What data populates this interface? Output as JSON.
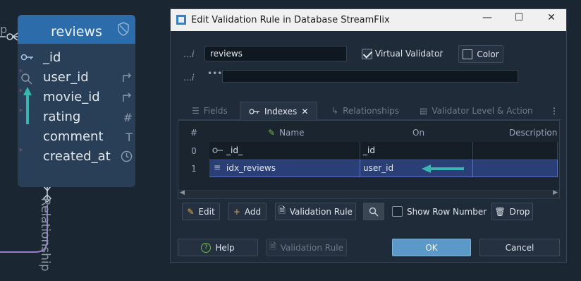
{
  "entity": {
    "name": "reviews",
    "fields": [
      {
        "name": "_id",
        "key_icon": "key-icon",
        "type_icon": ""
      },
      {
        "name": "user_id",
        "key_icon": "search-icon",
        "type_icon": "arrow-right-icon"
      },
      {
        "name": "movie_id",
        "key_icon": "",
        "type_icon": "arrow-right-icon"
      },
      {
        "name": "rating",
        "key_icon": "",
        "type_icon": "#"
      },
      {
        "name": "comment",
        "key_icon": "",
        "type_icon": "T"
      },
      {
        "name": "created_at",
        "key_icon": "",
        "type_icon": "clock-icon"
      }
    ],
    "relationship_label": "Relationship",
    "edge_label_fragment": "p"
  },
  "dialog": {
    "title": "Edit Validation Rule in Database StreamFlix",
    "name_value": "reviews",
    "virtual_validator_label": "Virtual Validator",
    "virtual_validator_checked": true,
    "color_label": "Color",
    "comment_value": "",
    "tabs": [
      {
        "label": "Fields",
        "active": false
      },
      {
        "label": "Indexes",
        "active": true
      },
      {
        "label": "Relationships",
        "active": false
      },
      {
        "label": "Validator Level & Action",
        "active": false
      }
    ],
    "grid": {
      "headers": {
        "num": "#",
        "name": "Name",
        "on": "On",
        "description": "Description"
      },
      "rows": [
        {
          "num": "0",
          "name": "_id_",
          "on": "_id",
          "description": "",
          "selected": false
        },
        {
          "num": "1",
          "name": "idx_reviews",
          "on": "user_id",
          "description": "",
          "selected": true
        }
      ]
    },
    "toolbar": {
      "edit": "Edit",
      "add": "Add",
      "validation_rule": "Validation Rule",
      "show_row_number": "Show Row Number",
      "drop": "Drop"
    },
    "footer": {
      "help": "Help",
      "validation_rule": "Validation Rule",
      "ok": "OK",
      "cancel": "Cancel"
    }
  },
  "colors": {
    "canvas": "#1b2633",
    "entity_header": "#2d6cab",
    "entity_body": "#283f57",
    "annotation_arrow": "#3ab6b0",
    "selected_row": "#2a3f78",
    "ok_button": "#5b99c9"
  }
}
